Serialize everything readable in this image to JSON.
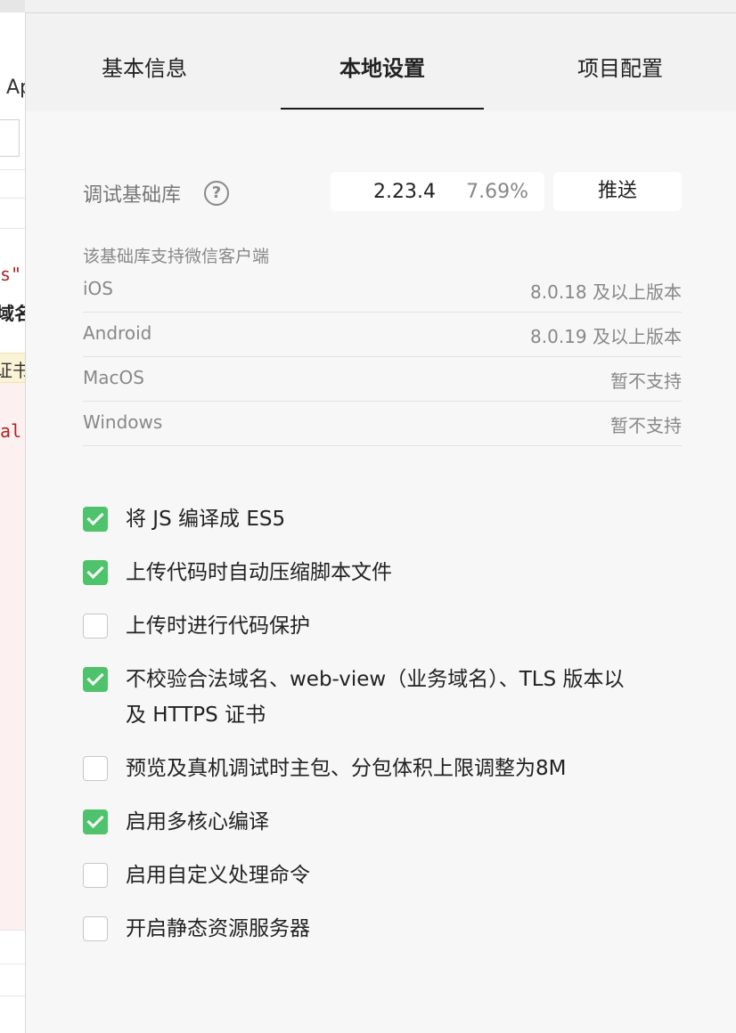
{
  "background_editor": {
    "ap_text": "Ap",
    "code_red_1": "s\"",
    "code_dark": "域名",
    "highlight_text": "证书",
    "code_red_2": "al"
  },
  "tabs": [
    {
      "label": "基本信息",
      "active": false
    },
    {
      "label": "本地设置",
      "active": true
    },
    {
      "label": "项目配置",
      "active": false
    }
  ],
  "base_library": {
    "label": "调试基础库",
    "help_icon": "question-circle-icon",
    "version": "2.23.4",
    "percent": "7.69%",
    "push_label": "推送"
  },
  "support": {
    "title": "该基础库支持微信客户端",
    "rows": [
      {
        "os": "iOS",
        "value": "8.0.18 及以上版本"
      },
      {
        "os": "Android",
        "value": "8.0.19 及以上版本"
      },
      {
        "os": "MacOS",
        "value": "暂不支持"
      },
      {
        "os": "Windows",
        "value": "暂不支持"
      }
    ]
  },
  "options": [
    {
      "label": "将 JS 编译成 ES5",
      "checked": true
    },
    {
      "label": "上传代码时自动压缩脚本文件",
      "checked": true
    },
    {
      "label": "上传时进行代码保护",
      "checked": false
    },
    {
      "label": "不校验合法域名、web-view（业务域名）、TLS 版本以及 HTTPS 证书",
      "checked": true
    },
    {
      "label": "预览及真机调试时主包、分包体积上限调整为8M",
      "checked": false
    },
    {
      "label": "启用多核心编译",
      "checked": true
    },
    {
      "label": "启用自定义处理命令",
      "checked": false
    },
    {
      "label": "开启静态资源服务器",
      "checked": false
    }
  ],
  "colors": {
    "checkbox_checked": "#4ec36b",
    "panel_bg": "#f7f7f7",
    "tab_bar_bg": "#f2f2f2"
  }
}
